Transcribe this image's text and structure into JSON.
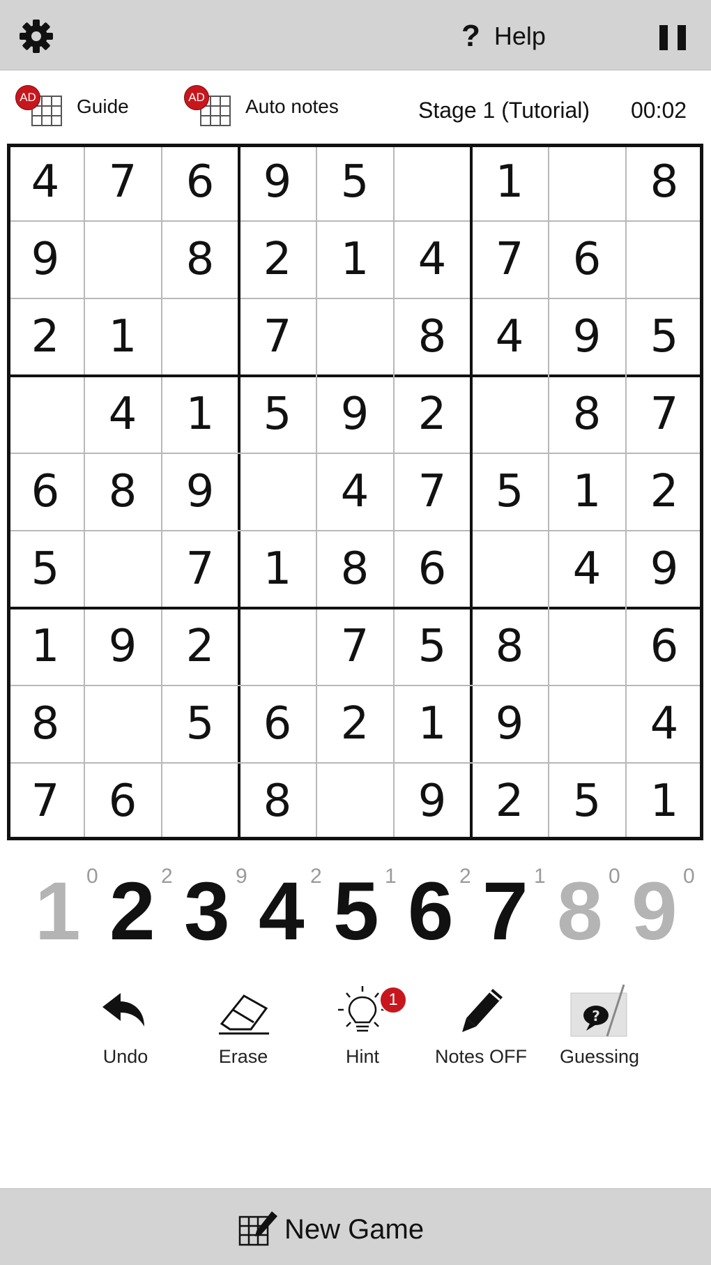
{
  "topbar": {
    "help_label": "Help",
    "help_glyph": "?"
  },
  "toolbar": {
    "guide_label": "Guide",
    "auto_notes_label": "Auto notes",
    "ad_badge": "AD",
    "stage": "Stage 1 (Tutorial)",
    "timer": "00:02"
  },
  "board": {
    "grid": [
      [
        4,
        7,
        6,
        9,
        5,
        0,
        1,
        0,
        8
      ],
      [
        9,
        0,
        8,
        2,
        1,
        4,
        7,
        6,
        0
      ],
      [
        2,
        1,
        0,
        7,
        0,
        8,
        4,
        9,
        5
      ],
      [
        0,
        4,
        1,
        5,
        9,
        2,
        0,
        8,
        7
      ],
      [
        6,
        8,
        9,
        0,
        4,
        7,
        5,
        1,
        2
      ],
      [
        5,
        0,
        7,
        1,
        8,
        6,
        0,
        4,
        9
      ],
      [
        1,
        9,
        2,
        0,
        7,
        5,
        8,
        0,
        6
      ],
      [
        8,
        0,
        5,
        6,
        2,
        1,
        9,
        0,
        4
      ],
      [
        7,
        6,
        0,
        8,
        0,
        9,
        2,
        5,
        1
      ]
    ]
  },
  "numpad": {
    "digits": [
      "1",
      "2",
      "3",
      "4",
      "5",
      "6",
      "7",
      "8",
      "9"
    ],
    "remaining": [
      "0",
      "2",
      "9",
      "2",
      "1",
      "2",
      "1",
      "0",
      "0"
    ]
  },
  "actions": {
    "undo": "Undo",
    "erase": "Erase",
    "hint": "Hint",
    "hint_count": "1",
    "notes": "Notes OFF",
    "guessing": "Guessing"
  },
  "bottom": {
    "new_game": "New Game"
  },
  "colors": {
    "bar_bg": "#d3d3d3",
    "badge_red": "#c8161d",
    "completed_digit": "#b4b4b4"
  }
}
